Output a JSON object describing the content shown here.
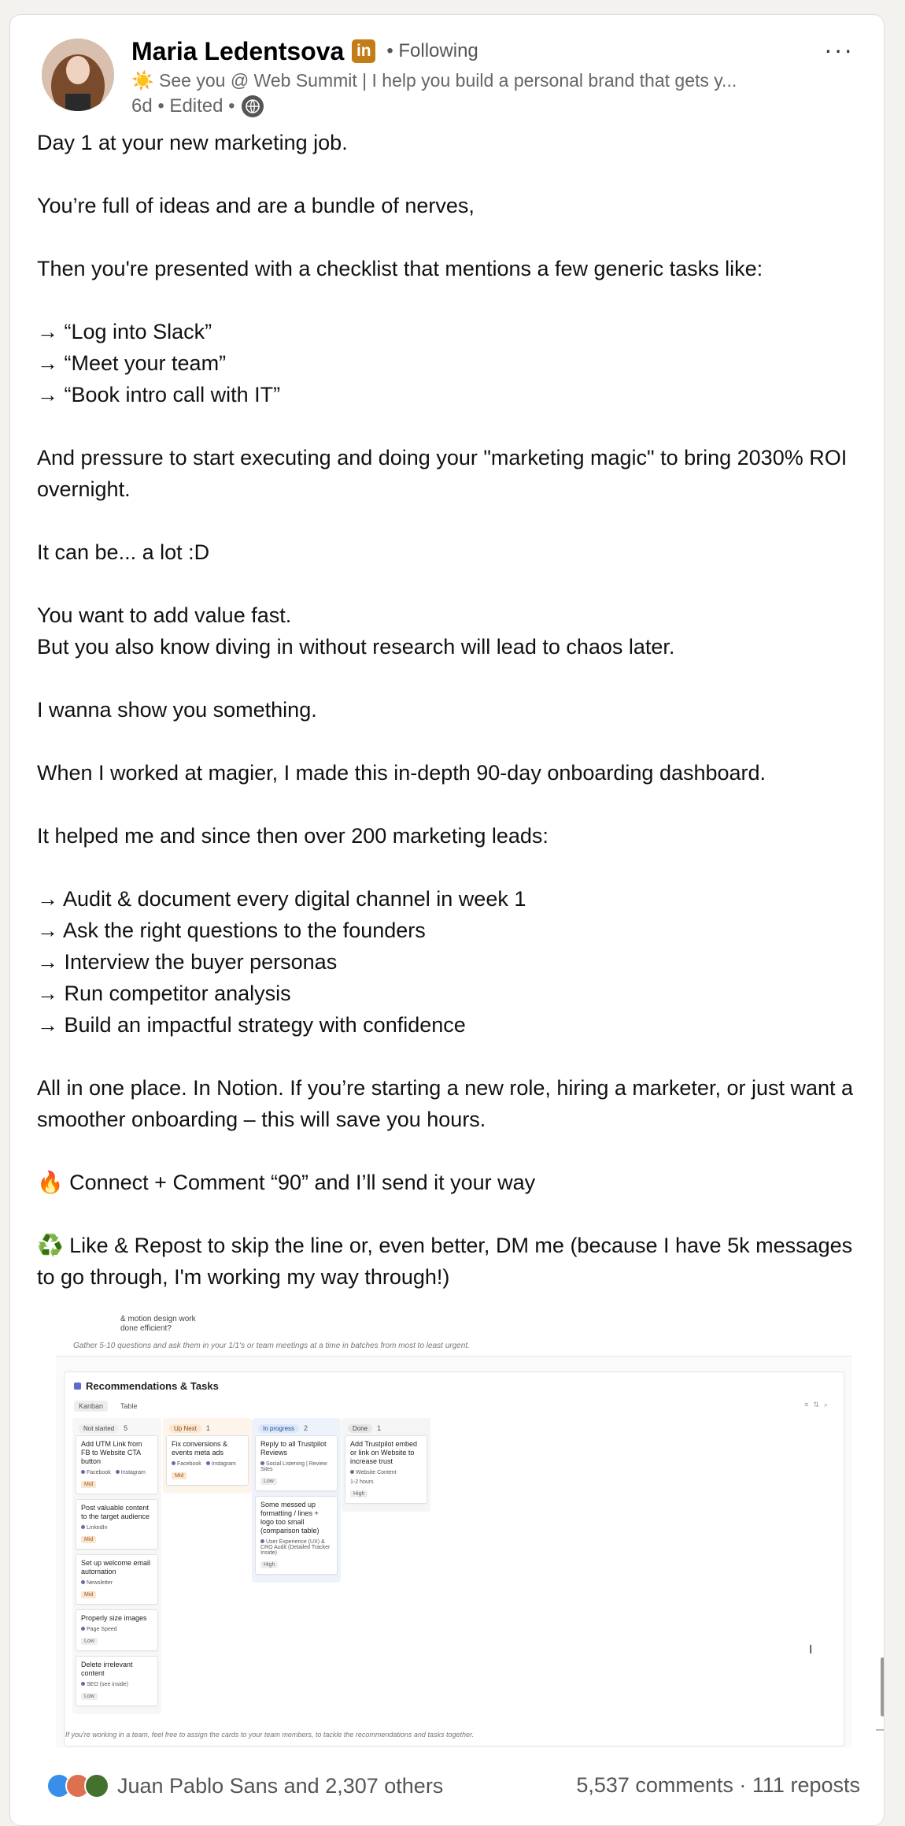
{
  "author": {
    "name": "Maria Ledentsova",
    "badge": "in",
    "following": "• Following",
    "headline": "☀️ See you @ Web Summit | I help you build a personal brand that gets y...",
    "meta_time": "6d • Edited •"
  },
  "menu": {
    "more": "···"
  },
  "post": {
    "lines": [
      "Day 1 at your new marketing job.",
      "",
      "You’re full of ideas and are a bundle of nerves,",
      "",
      "Then you're presented with a checklist that mentions a few generic tasks like:",
      "",
      "→ “Log into Slack”",
      "→ “Meet your team”",
      "→ “Book intro call with IT”",
      "",
      "And pressure to start executing and doing your \"marketing magic\" to bring 2030% ROI overnight.",
      "",
      "It can be... a lot :D",
      "",
      "You want to add value fast.",
      "But you also know diving in without research will lead to chaos later.",
      "",
      "I wanna show you something.",
      "",
      "When I worked at magier, I made this in-depth 90-day onboarding dashboard.",
      "",
      "It helped me and since then over 200 marketing leads:",
      "",
      "→ Audit & document every digital channel in week 1",
      "→ Ask the right questions to the founders",
      "→ Interview the buyer personas",
      "→ Run competitor analysis",
      "→ Build an impactful strategy with confidence",
      "",
      "All in one place. In Notion. If you’re starting a new role, hiring a marketer, or just want a smoother onboarding – this will save you hours.",
      "",
      "🔥 Connect + Comment “90” and I’ll send it your way",
      "",
      "♻️ Like & Repost to skip the line or, even better, DM me (because I have 5k messages to go through, I'm working my way through!)"
    ]
  },
  "screenshot": {
    "top_question": "& motion design work done efficient?",
    "gather_note": "Gather 5-10 questions and ask them in your 1/1's or team meetings at a time in batches from most to least urgent.",
    "title": "Recommendations & Tasks",
    "views": [
      "Kanban",
      "Table"
    ],
    "columns": [
      {
        "status": "Not started",
        "count": "5",
        "cards": [
          {
            "title": "Add UTM Link from FB to Website CTA button",
            "labels": [
              "Facebook",
              "Instagram"
            ],
            "priority": "Mid"
          },
          {
            "title": "Post valuable content to the target audience",
            "labels": [
              "LinkedIn"
            ],
            "priority": "Mid"
          },
          {
            "title": "Set up welcome email automation",
            "labels": [
              "Newsletter"
            ],
            "priority": "Mid"
          },
          {
            "title": "Properly size images",
            "labels": [
              "Page Speed"
            ],
            "priority": "Low"
          },
          {
            "title": "Delete irrelevant content",
            "labels": [
              "SEO (see inside)"
            ],
            "priority": "Low"
          }
        ]
      },
      {
        "status": "Up Next",
        "count": "1",
        "cards": [
          {
            "title": "Fix conversions & events meta ads",
            "labels": [
              "Facebook",
              "Instagram"
            ],
            "priority": "Mid"
          }
        ]
      },
      {
        "status": "In progress",
        "count": "2",
        "cards": [
          {
            "title": "Reply to all Trustpilot Reviews",
            "labels": [
              "Social Listening | Review Sites"
            ],
            "priority": "Low"
          },
          {
            "title": "Some messed up formatting / lines + logo too small (comparison table)",
            "labels": [
              "User Experience (UX) & CRO Audit (Detailed Tracker Inside)"
            ],
            "priority": "High"
          }
        ]
      },
      {
        "status": "Done",
        "count": "1",
        "cards": [
          {
            "title": "Add Trustpilot embed or link on Website to increase trust",
            "labels": [
              "Website Content"
            ],
            "extra": "1-2 hours",
            "priority": "High"
          }
        ]
      }
    ],
    "footer_note": "If you're working in a team, feel free to assign the cards to your team members, to tackle the recommendations and tasks together."
  },
  "social": {
    "reactors": "Juan Pablo Sans and 2,307 others",
    "stats": "5,537 comments · 111 reposts"
  }
}
